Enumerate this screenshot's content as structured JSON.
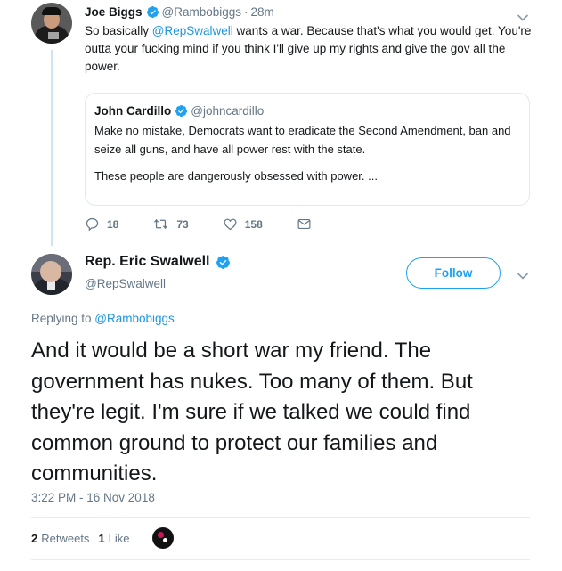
{
  "tweet1": {
    "author_name": "Joe Biggs",
    "author_handle": "@Rambobiggs",
    "separator": "·",
    "time": "28m",
    "text_before": "So basically ",
    "mention": "@RepSwalwell",
    "text_after": " wants a war. Because that's what you would get. You're outta your fucking mind if you think I'll give up my rights and give the gov all the power.",
    "quoted": {
      "author_name": "John Cardillo",
      "author_handle": "@johncardillo",
      "text": "Make no mistake, Democrats want to eradicate the Second Amendment, ban and seize all guns, and have all power rest with the state.",
      "text2": "These people are dangerously obsessed with power.  ..."
    },
    "actions": {
      "replies": "18",
      "retweets": "73",
      "likes": "158"
    }
  },
  "tweet2": {
    "author_name": "Rep. Eric Swalwell",
    "author_handle": "@RepSwalwell",
    "follow_label": "Follow",
    "replying_prefix": "Replying to ",
    "replying_handle": "@Rambobiggs",
    "text": "And it would be a short war my friend. The government has nukes. Too many of them. But they're legit. I'm sure if we talked we could find common ground to protect our families and communities.",
    "timestamp": "3:22 PM - 16 Nov 2018",
    "stats": {
      "retweets_count": "2",
      "retweets_label": "Retweets",
      "likes_count": "1",
      "likes_label": "Like"
    }
  },
  "colors": {
    "accent": "#1da1f2",
    "link": "#1b95e0",
    "muted": "#657786",
    "text": "#14171a"
  },
  "icons": [
    "verified-badge-icon",
    "chevron-down-icon",
    "reply-icon",
    "retweet-icon",
    "like-icon",
    "direct-message-icon"
  ]
}
